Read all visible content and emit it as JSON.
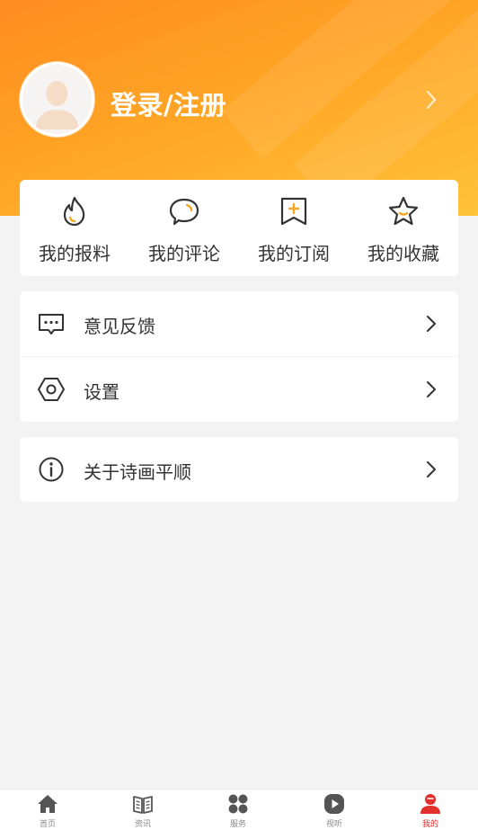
{
  "profile": {
    "login_label": "登录/注册"
  },
  "quick_actions": [
    {
      "label": "我的报料",
      "icon": "flame-icon"
    },
    {
      "label": "我的评论",
      "icon": "comment-bubble-icon"
    },
    {
      "label": "我的订阅",
      "icon": "bookmark-plus-icon"
    },
    {
      "label": "我的收藏",
      "icon": "star-icon"
    }
  ],
  "menu": {
    "feedback": {
      "label": "意见反馈",
      "icon": "message-dots-icon"
    },
    "settings": {
      "label": "设置",
      "icon": "hexagon-settings-icon"
    },
    "about": {
      "label": "关于诗画平顺",
      "icon": "info-icon"
    }
  },
  "tabbar": [
    {
      "label": "首页",
      "icon": "home-icon",
      "active": false
    },
    {
      "label": "资讯",
      "icon": "newspaper-icon",
      "active": false
    },
    {
      "label": "服务",
      "icon": "grid-icon",
      "active": false
    },
    {
      "label": "视听",
      "icon": "play-icon",
      "active": false
    },
    {
      "label": "我的",
      "icon": "user-icon",
      "active": true
    }
  ],
  "colors": {
    "header_gradient_start": "#ff8c1f",
    "header_gradient_end": "#ffc23a",
    "icon_accent": "#f5a623",
    "active_tab": "#e2312a",
    "background": "#f3f3f3"
  }
}
